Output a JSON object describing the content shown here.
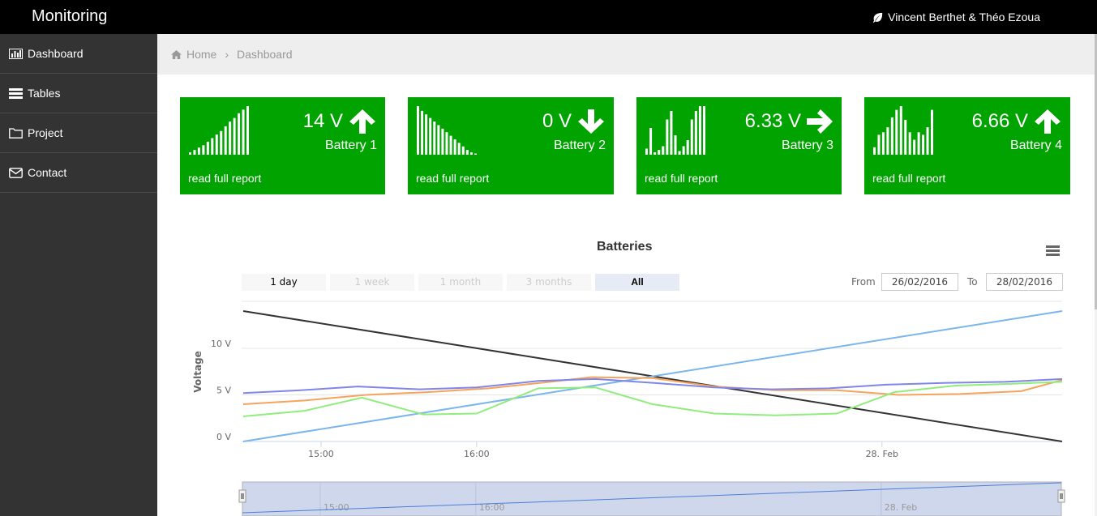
{
  "app": {
    "title": "Monitoring",
    "user": "Vincent Berthet & Théo Ezoua"
  },
  "sidebar": {
    "items": [
      {
        "label": "Dashboard",
        "icon": "bar-chart-icon"
      },
      {
        "label": "Tables",
        "icon": "table-icon"
      },
      {
        "label": "Project",
        "icon": "folder-icon"
      },
      {
        "label": "Contact",
        "icon": "envelope-icon"
      }
    ]
  },
  "breadcrumb": {
    "home": "Home",
    "current": "Dashboard"
  },
  "cards": [
    {
      "value": "14 V",
      "name": "Battery 1",
      "trend": "up",
      "link": "read full report",
      "spark": [
        2,
        4,
        6,
        8,
        11,
        14,
        17,
        20,
        24,
        28,
        31,
        35,
        38,
        41
      ]
    },
    {
      "value": "0 V",
      "name": "Battery 2",
      "trend": "down",
      "link": "read full report",
      "spark": [
        41,
        37,
        34,
        31,
        28,
        25,
        22,
        19,
        16,
        13,
        10,
        7,
        4,
        2,
        1
      ]
    },
    {
      "value": "6.33 V",
      "name": "Battery 3",
      "trend": "right",
      "link": "read full report",
      "spark": [
        5,
        22,
        2,
        4,
        7,
        29,
        36,
        16,
        3,
        7,
        12,
        29,
        36,
        40,
        40
      ]
    },
    {
      "value": "6.66 V",
      "name": "Battery 4",
      "trend": "up",
      "link": "read full report",
      "spark": [
        6,
        16,
        18,
        22,
        30,
        36,
        39,
        28,
        18,
        12,
        18,
        16,
        22,
        36
      ]
    }
  ],
  "colors": {
    "card_green": "#00a300",
    "top_bar": "#000000",
    "sidebar": "#333333"
  },
  "range_selector": {
    "buttons": [
      {
        "label": "1 day",
        "state": "enabled"
      },
      {
        "label": "1 week",
        "state": "disabled"
      },
      {
        "label": "1 month",
        "state": "disabled"
      },
      {
        "label": "3 months",
        "state": "disabled"
      },
      {
        "label": "All",
        "state": "selected"
      }
    ],
    "from_label": "From",
    "from_value": "26/02/2016",
    "to_label": "To",
    "to_value": "28/02/2016"
  },
  "chart_data": {
    "type": "line",
    "title": "Batteries",
    "ylabel": "Voltage",
    "ylim": [
      0,
      14
    ],
    "xlim": [
      0,
      20
    ],
    "y_ticks": [
      {
        "value": 0,
        "label": "0 V"
      },
      {
        "value": 5,
        "label": "5 V"
      },
      {
        "value": 10,
        "label": "10 V"
      }
    ],
    "x_ticks": [
      {
        "x": 1.9,
        "label": "15:00"
      },
      {
        "x": 5.7,
        "label": "16:00"
      },
      {
        "x": 15.6,
        "label": "28. Feb"
      }
    ],
    "grid": true,
    "series": [
      {
        "color": "#333333",
        "x": [
          0,
          20
        ],
        "y": [
          14,
          0
        ]
      },
      {
        "color": "#7cb5ec",
        "x": [
          0,
          20
        ],
        "y": [
          0,
          14
        ]
      },
      {
        "color": "#f7a35c",
        "x": [
          0,
          1.5,
          3,
          4.5,
          6,
          7.5,
          8.5,
          10,
          11.5,
          13,
          14.5,
          16,
          17.5,
          19,
          20
        ],
        "y": [
          4,
          4.4,
          5,
          5.3,
          5.7,
          6.4,
          6.9,
          6.8,
          5.9,
          5.5,
          5.5,
          5,
          5.1,
          5.4,
          6.6
        ]
      },
      {
        "color": "#90ed7d",
        "x": [
          0,
          1.5,
          2.9,
          4.4,
          5.7,
          7.2,
          8.6,
          10,
          11.5,
          13,
          14.5,
          15.9,
          17.4,
          18.8,
          20
        ],
        "y": [
          2.7,
          3.3,
          4.7,
          2.9,
          3,
          5.7,
          5.8,
          4,
          3,
          2.8,
          3,
          5.3,
          6,
          6.2,
          6.4
        ]
      },
      {
        "color": "#8085e9",
        "x": [
          0,
          1.4,
          2.8,
          4.3,
          5.7,
          7.2,
          8.6,
          10,
          11.5,
          12.9,
          14.3,
          15.7,
          17.2,
          18.6,
          20
        ],
        "y": [
          5.2,
          5.5,
          5.9,
          5.6,
          5.8,
          6.5,
          6.7,
          6.3,
          5.8,
          5.6,
          5.7,
          6.1,
          6.3,
          6.4,
          6.7
        ]
      }
    ]
  }
}
